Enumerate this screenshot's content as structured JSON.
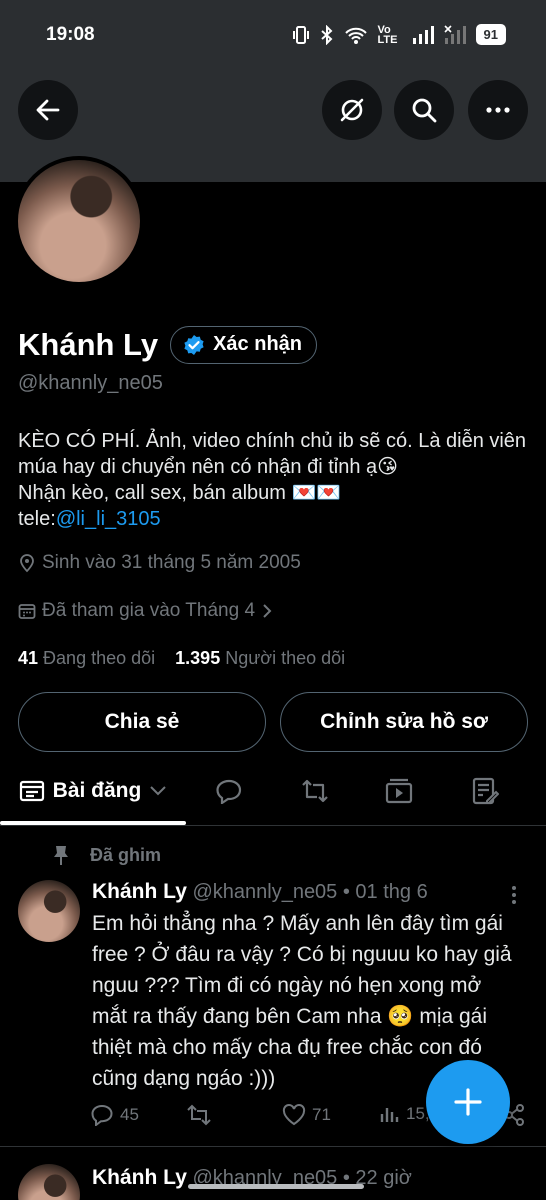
{
  "status_bar": {
    "time": "19:08",
    "network": "Vo LTE",
    "battery": "91"
  },
  "header": {
    "back_icon": "arrow-left-icon",
    "grok_icon": "grok-icon",
    "search_icon": "search-icon",
    "more_icon": "more-horizontal-icon"
  },
  "profile": {
    "name": "Khánh Ly",
    "verify_label": "Xác nhận",
    "handle": "@khannly_ne05",
    "bio_line1": "KÈO CÓ PHÍ. Ảnh, video chính chủ ib sẽ có. Là diễn viên múa hay di chuyển nên có nhận đi tỉnh ạ😘",
    "bio_line2": "Nhận kèo, call sex, bán album 💌💌",
    "bio_tele_prefix": "tele:",
    "bio_tele_link": "@li_li_3105",
    "birthday": "Sinh vào 31 tháng 5 năm 2005",
    "joined": "Đã tham gia vào Tháng 4",
    "following_count": "41",
    "following_label": "Đang theo dõi",
    "followers_count": "1.395",
    "followers_label": "Người theo dõi",
    "share_label": "Chia sẻ",
    "edit_label": "Chỉnh sửa hồ sơ"
  },
  "tabs": {
    "posts_label": "Bài đăng",
    "items": [
      "posts-icon",
      "replies-icon",
      "reposts-icon",
      "media-icon",
      "articles-icon"
    ]
  },
  "pinned_post": {
    "pinned_label": "Đã ghim",
    "author": "Khánh Ly",
    "handle_time": "@khannly_ne05 • 01 thg 6",
    "text": "Em hỏi thẳng nha ? Mấy anh lên đây tìm gái free ? Ở đâu ra vậy ? Có bị nguuu ko hay giả nguu ??? Tìm đi có ngày nó hẹn xong mở mắt ra thấy đang bên Cam nha 🥺 mịa gái thiệt mà cho mấy cha đụ free chắc con đó cũng dạng ngáo :)))",
    "replies": "45",
    "likes": "71",
    "views": "15,"
  },
  "next_post": {
    "author": "Khánh Ly",
    "handle_time": "@khannly_ne05 • 22 giờ"
  },
  "colors": {
    "accent": "#1d9bf0",
    "banner": "#2b2e31",
    "muted": "#71767b"
  }
}
